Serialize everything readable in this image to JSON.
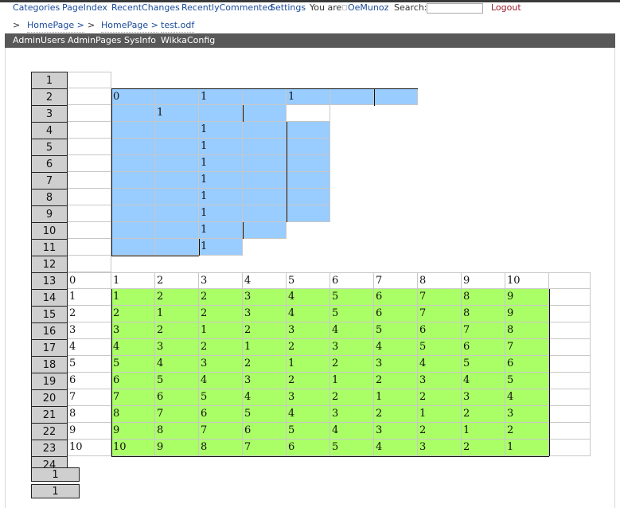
{
  "nav": {
    "categories": "Categories",
    "page_index": "PageIndex",
    "recent_changes": "RecentChanges",
    "recently_commented": "RecentlyCommented",
    "settings": "Settings",
    "you_are": "You are",
    "user": "OeMunoz",
    "search_label": "Search:",
    "search_value": "",
    "logout": "Logout"
  },
  "breadcrumb": {
    "sep": ">",
    "items": [
      "HomePage >",
      "HomePage >",
      "test.odf"
    ]
  },
  "admin": [
    "AdminUsers",
    "AdminPages",
    "SysInfo",
    "WikkaConfig"
  ],
  "sheet": {
    "row_numbers": [
      "1",
      "2",
      "3",
      "4",
      "5",
      "6",
      "7",
      "8",
      "9",
      "10",
      "11",
      "12",
      "13",
      "14",
      "15",
      "16",
      "17",
      "18",
      "19",
      "20",
      "21",
      "22",
      "23",
      "24"
    ],
    "top_rows": [
      {
        "row": 2,
        "cells": [
          "0",
          "",
          "1",
          "",
          "1",
          "",
          ""
        ]
      },
      {
        "row": 3,
        "cells": [
          "",
          "1",
          "",
          "",
          ""
        ]
      },
      {
        "row": 4,
        "cells": [
          "",
          "",
          "1",
          "",
          ""
        ]
      },
      {
        "row": 5,
        "cells": [
          "",
          "",
          "1",
          "",
          ""
        ]
      },
      {
        "row": 6,
        "cells": [
          "",
          "",
          "1",
          "",
          ""
        ]
      },
      {
        "row": 7,
        "cells": [
          "",
          "",
          "1",
          "",
          ""
        ]
      },
      {
        "row": 8,
        "cells": [
          "",
          "",
          "1",
          "",
          ""
        ]
      },
      {
        "row": 9,
        "cells": [
          "",
          "",
          "1",
          "",
          ""
        ]
      },
      {
        "row": 10,
        "cells": [
          "",
          "",
          "1",
          ""
        ]
      },
      {
        "row": 11,
        "cells": [
          "",
          "",
          "1"
        ]
      }
    ],
    "table_header": [
      "0",
      "1",
      "2",
      "3",
      "4",
      "5",
      "6",
      "7",
      "8",
      "9",
      "10"
    ],
    "table_rows": [
      [
        "1",
        "1",
        "2",
        "2",
        "3",
        "4",
        "5",
        "6",
        "7",
        "8",
        "9"
      ],
      [
        "2",
        "2",
        "1",
        "2",
        "3",
        "4",
        "5",
        "6",
        "7",
        "8",
        "9"
      ],
      [
        "3",
        "3",
        "2",
        "1",
        "2",
        "3",
        "4",
        "5",
        "6",
        "7",
        "8"
      ],
      [
        "4",
        "4",
        "3",
        "2",
        "1",
        "2",
        "3",
        "4",
        "5",
        "6",
        "7"
      ],
      [
        "5",
        "5",
        "4",
        "3",
        "2",
        "1",
        "2",
        "3",
        "4",
        "5",
        "6"
      ],
      [
        "6",
        "6",
        "5",
        "4",
        "3",
        "2",
        "1",
        "2",
        "3",
        "4",
        "5"
      ],
      [
        "7",
        "7",
        "6",
        "5",
        "4",
        "3",
        "2",
        "1",
        "2",
        "3",
        "4"
      ],
      [
        "8",
        "8",
        "7",
        "6",
        "5",
        "4",
        "3",
        "2",
        "1",
        "2",
        "3"
      ],
      [
        "9",
        "9",
        "8",
        "7",
        "6",
        "5",
        "4",
        "3",
        "2",
        "1",
        "2"
      ],
      [
        "10",
        "10",
        "9",
        "8",
        "7",
        "6",
        "5",
        "4",
        "3",
        "2",
        "1"
      ]
    ],
    "footer_tabs": [
      "1",
      "1"
    ]
  },
  "colors": {
    "blue_block": "#99ccff",
    "green_block": "#aaff66",
    "header_gray": "#cfcfcf"
  }
}
